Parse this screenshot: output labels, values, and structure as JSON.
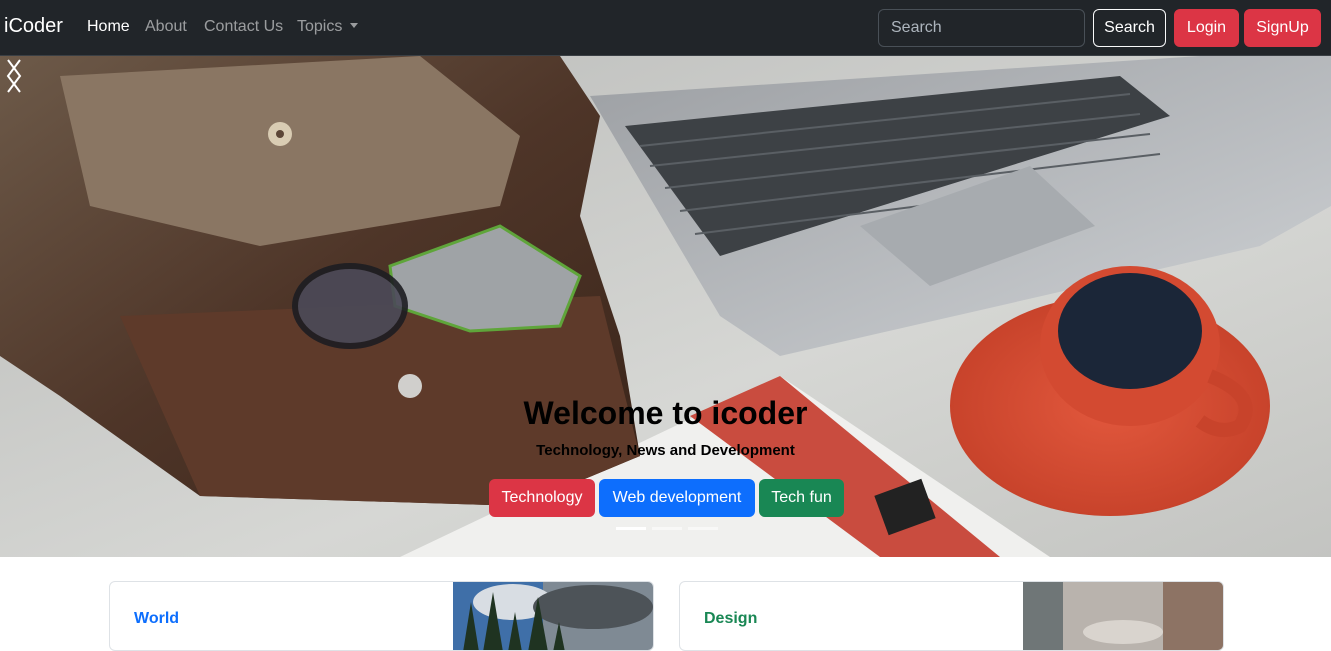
{
  "navbar": {
    "brand": "iCoder",
    "links": [
      "Home",
      "About",
      "Contact Us",
      "Topics"
    ],
    "search_placeholder": "Search",
    "search_button": "Search",
    "login_button": "Login",
    "signup_button": "SignUp"
  },
  "hero": {
    "title": "Welcome to icoder",
    "subtitle": "Technology, News and Development",
    "buttons": [
      "Technology",
      "Web development",
      "Tech fun"
    ],
    "active_slide": 1,
    "slide_count": 3
  },
  "cards": [
    {
      "category": "World"
    },
    {
      "category": "Design"
    }
  ],
  "colors": {
    "navbar_bg": "#212529",
    "danger": "#dc3545",
    "primary": "#0d6efd",
    "success": "#198754"
  }
}
